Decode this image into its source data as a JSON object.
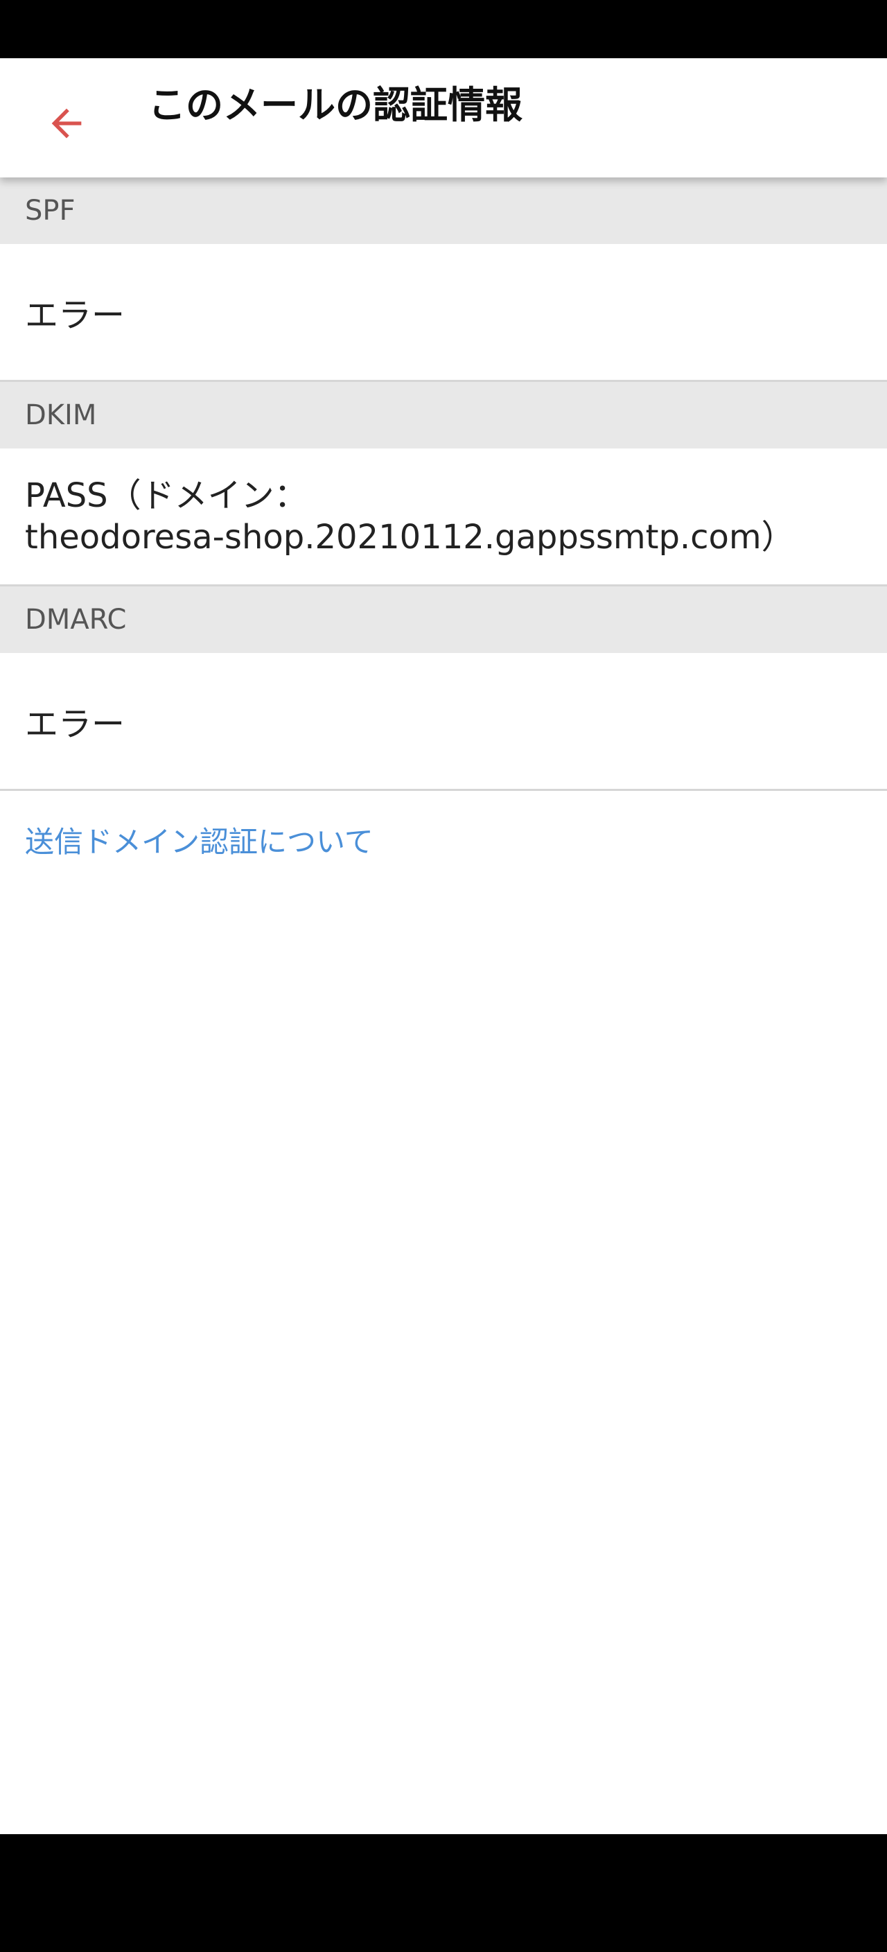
{
  "header": {
    "title": "このメールの認証情報",
    "back_icon": "arrow-left-icon",
    "accent_color": "#d9534f"
  },
  "sections": {
    "spf": {
      "label": "SPF",
      "value": "エラー"
    },
    "dkim": {
      "label": "DKIM",
      "value_line1": "PASS（ドメイン：",
      "value_line2": "theodoresa-shop.20210112.gappssmtp.com）"
    },
    "dmarc": {
      "label": "DMARC",
      "value": "エラー"
    }
  },
  "footer_link": {
    "label": "送信ドメイン認証について",
    "color": "#4a8fd8"
  }
}
